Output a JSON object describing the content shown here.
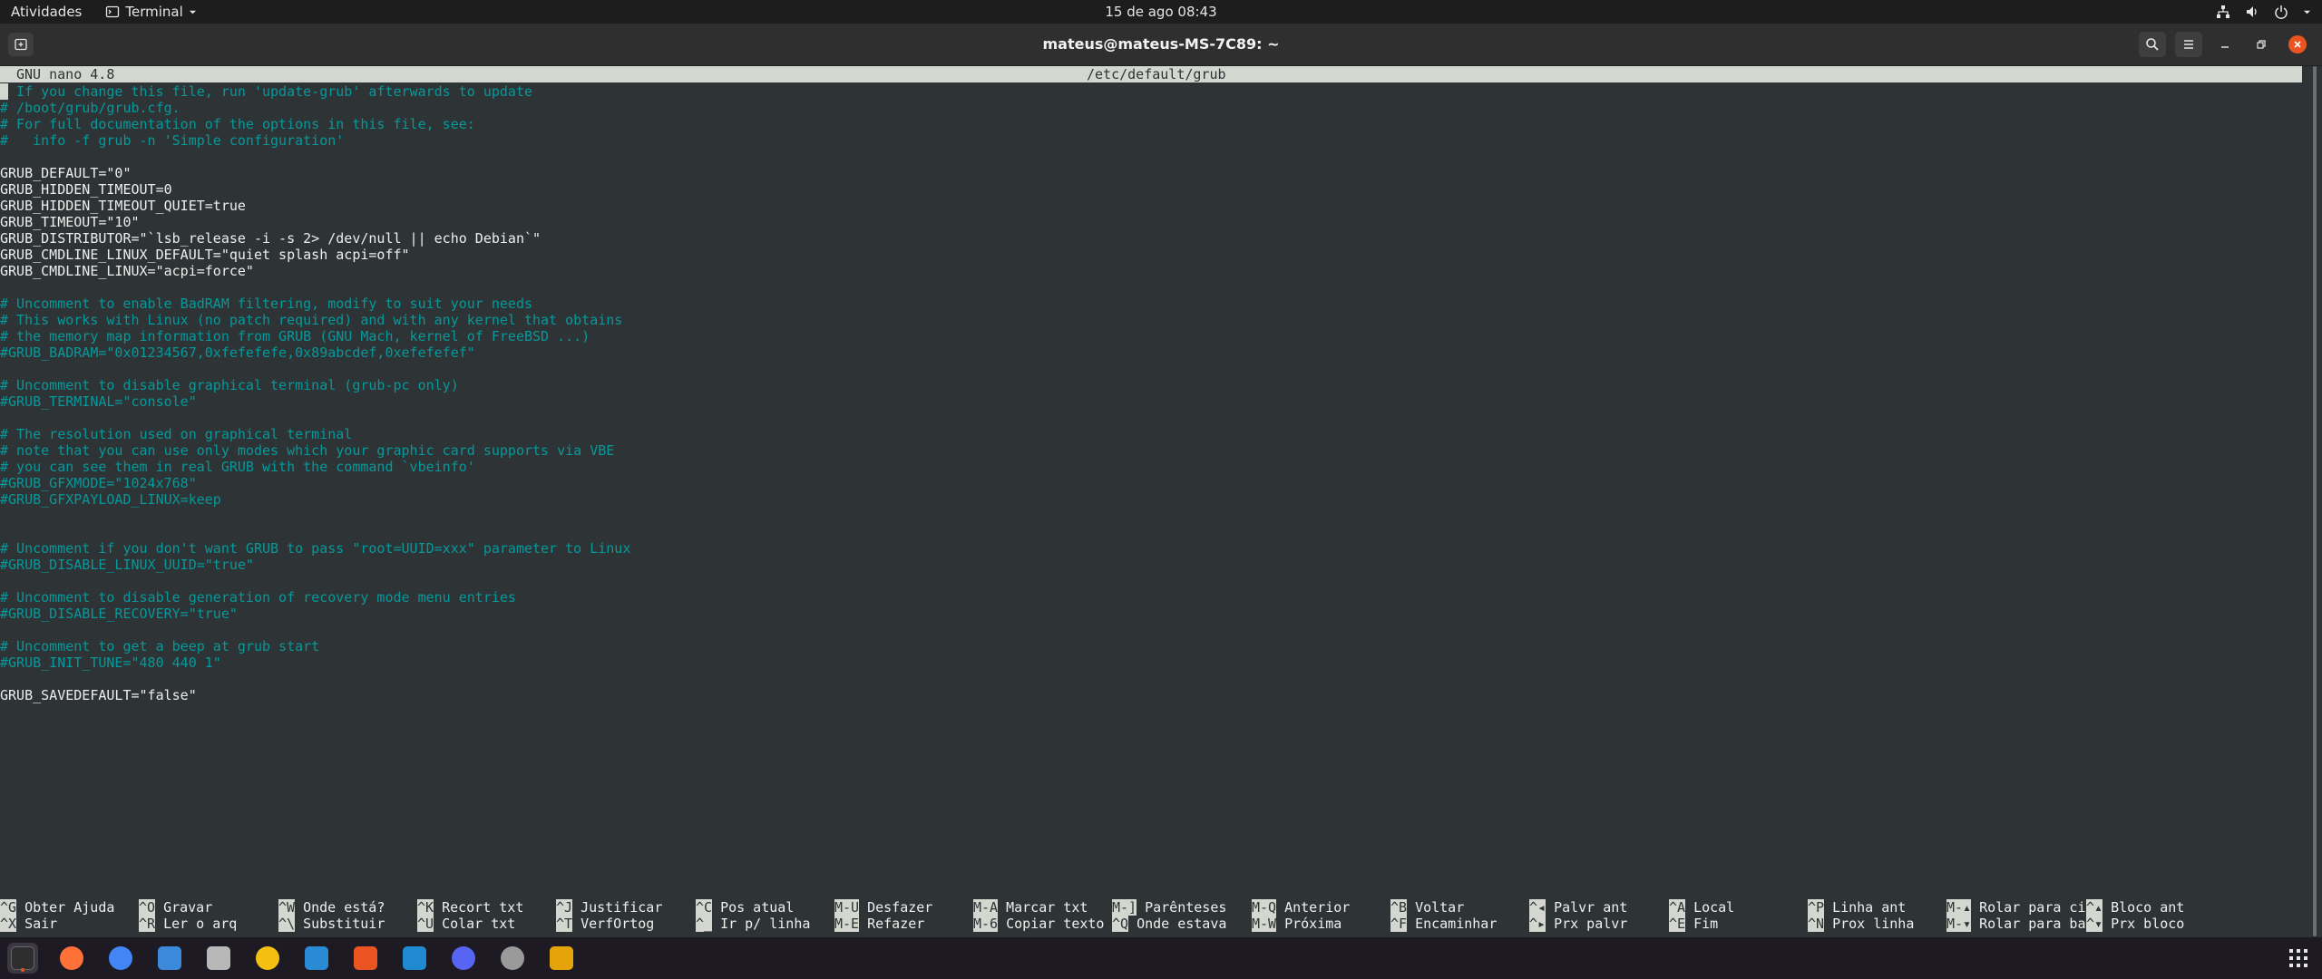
{
  "topbar": {
    "activities": "Atividades",
    "app_name": "Terminal",
    "clock": "15 de ago  08:43"
  },
  "window": {
    "title": "mateus@mateus-MS-7C89: ~"
  },
  "nano": {
    "version": "GNU nano 4.8",
    "filename": "/etc/default/grub",
    "lines": [
      {
        "text": "# If you change this file, run 'update-grub' afterwards to update",
        "type": "comment"
      },
      {
        "text": "# /boot/grub/grub.cfg.",
        "type": "comment"
      },
      {
        "text": "# For full documentation of the options in this file, see:",
        "type": "comment"
      },
      {
        "text": "#   info -f grub -n 'Simple configuration'",
        "type": "comment"
      },
      {
        "text": "",
        "type": "blank"
      },
      {
        "text": "GRUB_DEFAULT=\"0\"",
        "type": "code"
      },
      {
        "text": "GRUB_HIDDEN_TIMEOUT=0",
        "type": "code"
      },
      {
        "text": "GRUB_HIDDEN_TIMEOUT_QUIET=true",
        "type": "code"
      },
      {
        "text": "GRUB_TIMEOUT=\"10\"",
        "type": "code"
      },
      {
        "text": "GRUB_DISTRIBUTOR=\"`lsb_release -i -s 2> /dev/null || echo Debian`\"",
        "type": "code"
      },
      {
        "text": "GRUB_CMDLINE_LINUX_DEFAULT=\"quiet splash acpi=off\"",
        "type": "code"
      },
      {
        "text": "GRUB_CMDLINE_LINUX=\"acpi=force\"",
        "type": "code"
      },
      {
        "text": "",
        "type": "blank"
      },
      {
        "text": "# Uncomment to enable BadRAM filtering, modify to suit your needs",
        "type": "comment"
      },
      {
        "text": "# This works with Linux (no patch required) and with any kernel that obtains",
        "type": "comment"
      },
      {
        "text": "# the memory map information from GRUB (GNU Mach, kernel of FreeBSD ...)",
        "type": "comment"
      },
      {
        "text": "#GRUB_BADRAM=\"0x01234567,0xfefefefe,0x89abcdef,0xefefefef\"",
        "type": "comment"
      },
      {
        "text": "",
        "type": "blank"
      },
      {
        "text": "# Uncomment to disable graphical terminal (grub-pc only)",
        "type": "comment"
      },
      {
        "text": "#GRUB_TERMINAL=\"console\"",
        "type": "comment"
      },
      {
        "text": "",
        "type": "blank"
      },
      {
        "text": "# The resolution used on graphical terminal",
        "type": "comment"
      },
      {
        "text": "# note that you can use only modes which your graphic card supports via VBE",
        "type": "comment"
      },
      {
        "text": "# you can see them in real GRUB with the command `vbeinfo'",
        "type": "comment"
      },
      {
        "text": "#GRUB_GFXMODE=\"1024x768\"",
        "type": "comment"
      },
      {
        "text": "#GRUB_GFXPAYLOAD_LINUX=keep",
        "type": "comment"
      },
      {
        "text": "",
        "type": "blank"
      },
      {
        "text": "",
        "type": "blank"
      },
      {
        "text": "# Uncomment if you don't want GRUB to pass \"root=UUID=xxx\" parameter to Linux",
        "type": "comment"
      },
      {
        "text": "#GRUB_DISABLE_LINUX_UUID=\"true\"",
        "type": "comment"
      },
      {
        "text": "",
        "type": "blank"
      },
      {
        "text": "# Uncomment to disable generation of recovery mode menu entries",
        "type": "comment"
      },
      {
        "text": "#GRUB_DISABLE_RECOVERY=\"true\"",
        "type": "comment"
      },
      {
        "text": "",
        "type": "blank"
      },
      {
        "text": "# Uncomment to get a beep at grub start",
        "type": "comment"
      },
      {
        "text": "#GRUB_INIT_TUNE=\"480 440 1\"",
        "type": "comment"
      },
      {
        "text": "",
        "type": "blank"
      },
      {
        "text": "GRUB_SAVEDEFAULT=\"false\"",
        "type": "code"
      }
    ],
    "shortcuts_row1": [
      {
        "key": "^G",
        "label": "Obter Ajuda"
      },
      {
        "key": "^O",
        "label": "Gravar"
      },
      {
        "key": "^W",
        "label": "Onde está?"
      },
      {
        "key": "^K",
        "label": "Recort txt"
      },
      {
        "key": "^J",
        "label": "Justificar"
      },
      {
        "key": "^C",
        "label": "Pos atual"
      },
      {
        "key": "M-U",
        "label": "Desfazer"
      },
      {
        "key": "M-A",
        "label": "Marcar txt"
      },
      {
        "key": "M-]",
        "label": "Parênteses"
      },
      {
        "key": "M-Q",
        "label": "Anterior"
      },
      {
        "key": "^B",
        "label": "Voltar"
      },
      {
        "key": "^◂",
        "label": "Palvr ant"
      },
      {
        "key": "^A",
        "label": "Local"
      },
      {
        "key": "^P",
        "label": "Linha ant"
      },
      {
        "key": "M-▴",
        "label": "Rolar para ci"
      },
      {
        "key": "^▴",
        "label": "Bloco ant"
      }
    ],
    "shortcuts_row2": [
      {
        "key": "^X",
        "label": "Sair"
      },
      {
        "key": "^R",
        "label": "Ler o arq"
      },
      {
        "key": "^\\",
        "label": "Substituir"
      },
      {
        "key": "^U",
        "label": "Colar txt"
      },
      {
        "key": "^T",
        "label": "VerfOrtog"
      },
      {
        "key": "^_",
        "label": "Ir p/ linha"
      },
      {
        "key": "M-E",
        "label": "Refazer"
      },
      {
        "key": "M-6",
        "label": "Copiar texto"
      },
      {
        "key": "^Q",
        "label": "Onde estava"
      },
      {
        "key": "M-W",
        "label": "Próxima"
      },
      {
        "key": "^F",
        "label": "Encaminhar"
      },
      {
        "key": "^▸",
        "label": "Prx palvr"
      },
      {
        "key": "^E",
        "label": "Fim"
      },
      {
        "key": "^N",
        "label": "Prox linha"
      },
      {
        "key": "M-▾",
        "label": "Rolar para ba"
      },
      {
        "key": "^▾",
        "label": "Prx bloco"
      }
    ]
  },
  "dock": {
    "items": [
      {
        "name": "terminal-icon",
        "color": "#2e2e2e",
        "active": true
      },
      {
        "name": "firefox-icon",
        "color": "#ff7139"
      },
      {
        "name": "chrome-icon",
        "color": "#4285f4"
      },
      {
        "name": "thunderbird-icon",
        "color": "#3d89d9"
      },
      {
        "name": "files-icon",
        "color": "#b8b8b8"
      },
      {
        "name": "rhythmbox-icon",
        "color": "#f3c011"
      },
      {
        "name": "libreoffice-writer-icon",
        "color": "#2a8ad4"
      },
      {
        "name": "software-center-icon",
        "color": "#e95420"
      },
      {
        "name": "vscode-icon",
        "color": "#1f8ad2"
      },
      {
        "name": "discord-icon",
        "color": "#5865f2"
      },
      {
        "name": "settings-icon",
        "color": "#9a9a9a"
      },
      {
        "name": "calculator-icon",
        "color": "#e5a50a"
      }
    ]
  },
  "colors": {
    "comment": "#06989a",
    "text": "#eeeeec",
    "background": "#2e3436",
    "accent": "#e95420"
  }
}
